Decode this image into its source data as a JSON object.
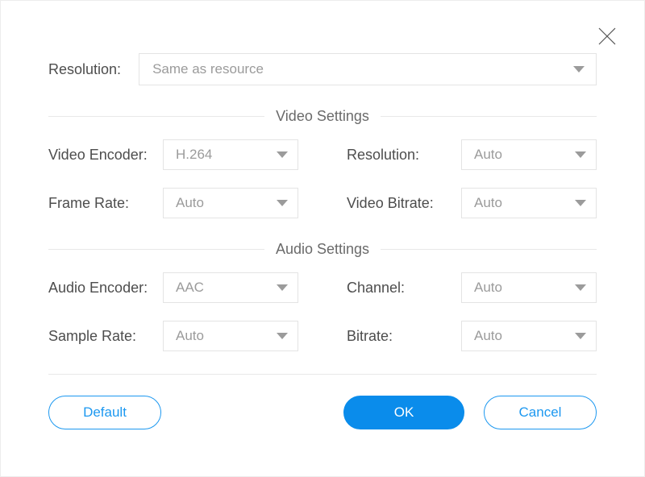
{
  "top": {
    "resolution_label": "Resolution:",
    "resolution_value": "Same as resource"
  },
  "sections": {
    "video_title": "Video Settings",
    "audio_title": "Audio Settings"
  },
  "video": {
    "encoder_label": "Video Encoder:",
    "encoder_value": "H.264",
    "frame_rate_label": "Frame Rate:",
    "frame_rate_value": "Auto",
    "resolution_label": "Resolution:",
    "resolution_value": "Auto",
    "bitrate_label": "Video Bitrate:",
    "bitrate_value": "Auto"
  },
  "audio": {
    "encoder_label": "Audio Encoder:",
    "encoder_value": "AAC",
    "sample_rate_label": "Sample Rate:",
    "sample_rate_value": "Auto",
    "channel_label": "Channel:",
    "channel_value": "Auto",
    "bitrate_label": "Bitrate:",
    "bitrate_value": "Auto"
  },
  "buttons": {
    "default": "Default",
    "ok": "OK",
    "cancel": "Cancel"
  }
}
